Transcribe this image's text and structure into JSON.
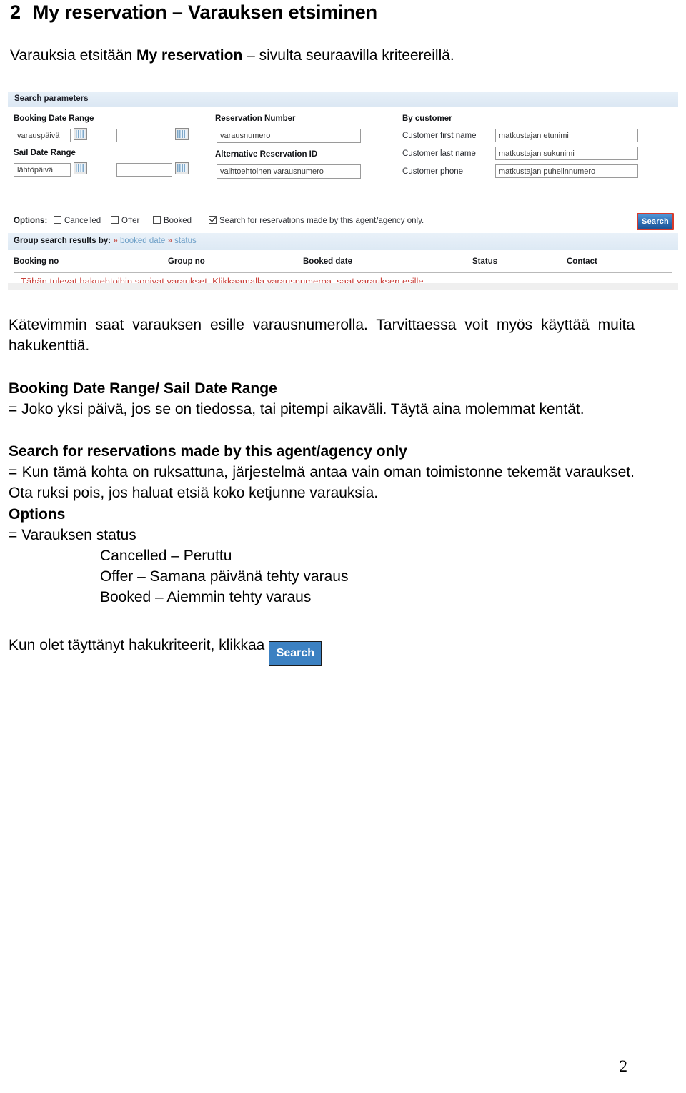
{
  "document": {
    "heading_number": "2",
    "heading_text": "My reservation – Varauksen  etsiminen",
    "intro_before": "Varauksia etsitään ",
    "intro_bold": "My reservation",
    "intro_after": " – sivulta seuraavilla kriteereillä.",
    "page_number": "2"
  },
  "screenshot": {
    "panel_title": "Search parameters",
    "fields": {
      "booking_date_range_label": "Booking Date Range",
      "booking_date_from_value": "varauspäivä",
      "booking_date_to_value": "",
      "sail_date_range_label": "Sail Date Range",
      "sail_date_from_value": "lähtöpäivä",
      "sail_date_to_value": "",
      "reservation_number_label": "Reservation Number",
      "reservation_number_value": "varausnumero",
      "alternative_reservation_id_label": "Alternative Reservation ID",
      "alternative_reservation_id_value": "vaihtoehtoinen varausnumero",
      "by_customer_label": "By customer",
      "customer_first_name_label": "Customer first name",
      "customer_first_name_value": "matkustajan etunimi",
      "customer_last_name_label": "Customer last name",
      "customer_last_name_value": "matkustajan sukunimi",
      "customer_phone_label": "Customer phone",
      "customer_phone_value": "matkustajan puhelinnumero"
    },
    "options": {
      "label": "Options:",
      "cancelled": "Cancelled",
      "offer": "Offer",
      "booked": "Booked",
      "agent_only": "Search for reservations made by this agent/agency only.",
      "cancelled_checked": false,
      "offer_checked": false,
      "booked_checked": false,
      "agent_only_checked": true
    },
    "search_button_label": "Search",
    "group_bar": {
      "label": "Group search results by:",
      "arrow": "»",
      "link_booked_date": "booked date",
      "link_status": "status"
    },
    "results_table": {
      "columns": [
        "Booking no",
        "Group no",
        "Booked date",
        "Status",
        "Contact"
      ],
      "empty_note": "Tähän tulevat hakuehtoihin sopivat varaukset. Klikkaamalla varausnumeroa, saat varauksen esille."
    },
    "colors": {
      "panel_bar": "#dfeaf5",
      "group_bar": "#e2ecf6",
      "search_button_border": "#d83a2c",
      "search_button_fill": "#2f6fb5",
      "note_red": "#c9413a",
      "link_blue": "#6d9fc7"
    }
  },
  "body": {
    "para1": "Kätevimmin saat varauksen esille varausnumerolla. Tarvittaessa voit myös käyttää muita hakukenttiä.",
    "section2_title": "Booking Date Range/ Sail Date Range",
    "section2_text": "= Joko yksi päivä, jos se on tiedossa, tai pitempi aikaväli. Täytä aina molemmat kentät.",
    "section3_title": "Search for reservations made by this agent/agency only",
    "section3_text": "= Kun tämä kohta on ruksattuna, järjestelmä antaa vain oman toimistonne tekemät varaukset. Ota ruksi pois, jos haluat etsiä koko ketjunne varauksia.",
    "section4_title": "Options",
    "section4_text": "= Varauksen status",
    "status_items": [
      "Cancelled – Peruttu",
      "Offer – Samana päivänä tehty varaus",
      "Booked – Aiemmin tehty varaus"
    ],
    "closing_text": "Kun olet täyttänyt hakukriteerit, klikkaa",
    "closing_button_label": "Search"
  }
}
